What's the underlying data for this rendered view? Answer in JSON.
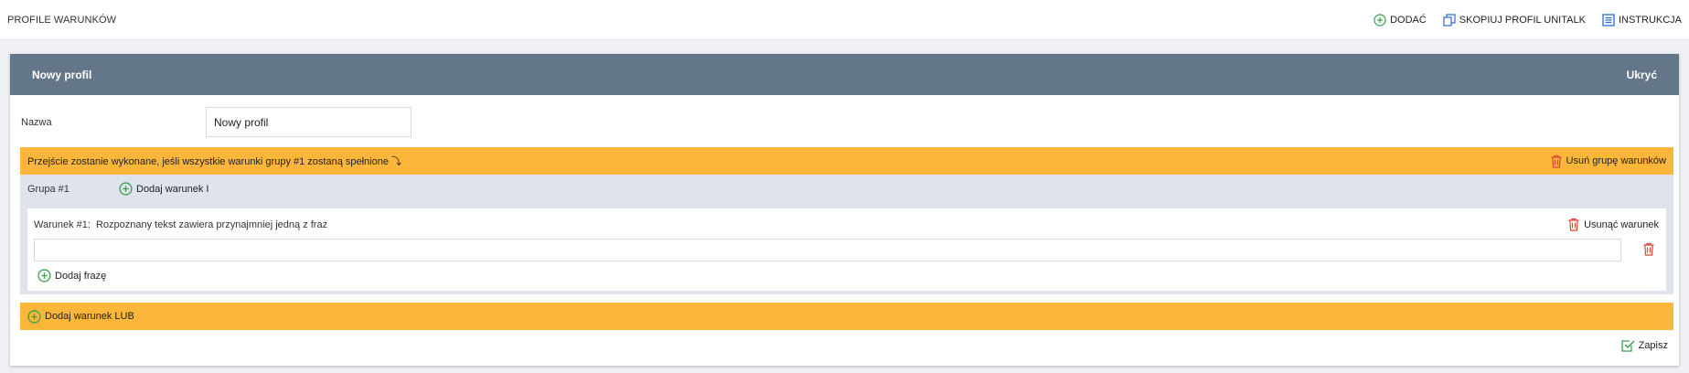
{
  "header": {
    "title": "PROFILE WARUNKÓW",
    "actions": [
      {
        "label": "DODAĆ",
        "icon": "plus-circle-icon"
      },
      {
        "label": "SKOPIUJ PROFIL UNITALK",
        "icon": "copy-icon"
      },
      {
        "label": "INSTRUKCJA",
        "icon": "document-icon"
      }
    ]
  },
  "panel": {
    "title": "Nowy profil",
    "hide_label": "Ukryć",
    "name_label": "Nazwa",
    "name_value": "Nowy profil"
  },
  "group": {
    "banner": "Przejście zostanie wykonane, jeśli wszystkie warunki grupy #1 zostaną spełnione ⤵",
    "remove_label": "Usuń grupę warunków",
    "title": "Grupa #1",
    "add_and_label": "Dodaj warunek I",
    "condition": {
      "title": "Warunek #1:",
      "description": "Rozpoznany tekst zawiera przynajmniej jedną z fraz",
      "remove_label": "Usunąć warunek",
      "phrase_value": "",
      "add_phrase_label": "Dodaj frazę"
    }
  },
  "add_or_label": "Dodaj warunek LUB",
  "save_label": "Zapisz",
  "colors": {
    "header_bg": "#64768a",
    "accent_orange": "#fcb73a",
    "group_bg": "#dfe4ec",
    "add_green": "#3aa04a",
    "delete_red": "#e0413a",
    "link_blue": "#2a6bd6"
  }
}
